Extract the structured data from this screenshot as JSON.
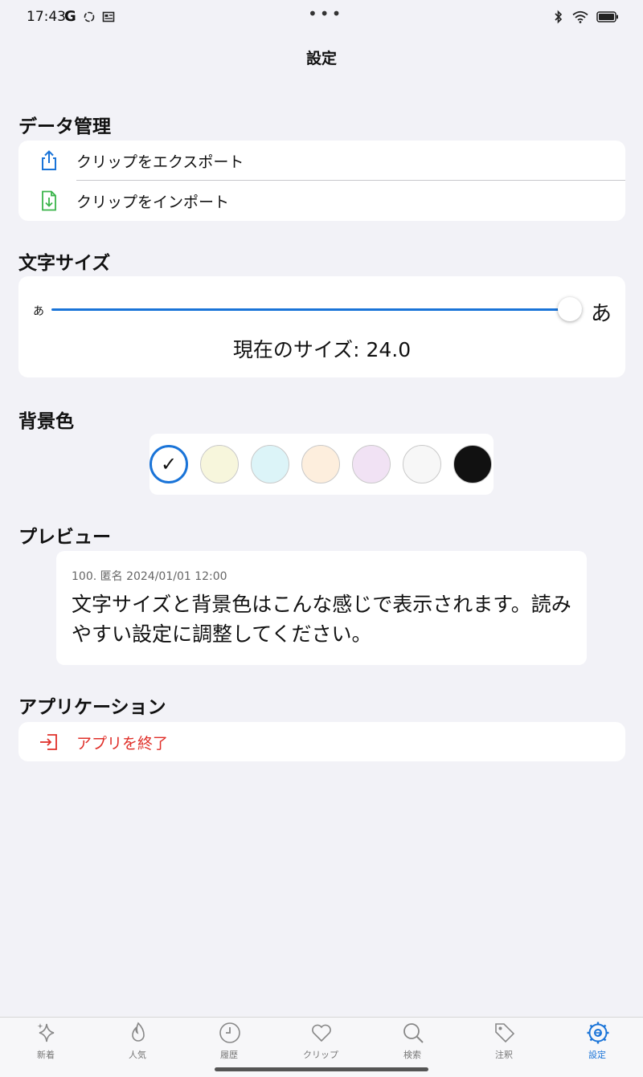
{
  "status": {
    "time": "17:43",
    "g_glyph": "G",
    "dots": "•••"
  },
  "nav": {
    "title": "設定"
  },
  "data_section": {
    "title": "データ管理",
    "export_label": "クリップをエクスポート",
    "import_label": "クリップをインポート",
    "export_icon": "share-icon",
    "import_icon": "file-import-icon"
  },
  "font_section": {
    "title": "文字サイズ",
    "small_glyph": "あ",
    "large_glyph": "あ",
    "readout": "現在のサイズ: 24.0",
    "slider_level": 1.0
  },
  "bg_section": {
    "title": "背景色",
    "check_glyph": "✓",
    "swatches": [
      {
        "color": "#ffffff",
        "selected": true
      },
      {
        "color": "#f7f6dc",
        "selected": false
      },
      {
        "color": "#dcf4f8",
        "selected": false
      },
      {
        "color": "#fdeedd",
        "selected": false
      },
      {
        "color": "#f1e2f4",
        "selected": false
      },
      {
        "color": "#f7f7f7",
        "selected": false
      },
      {
        "color": "#111111",
        "selected": false
      }
    ]
  },
  "preview_section": {
    "title": "プレビュー",
    "meta": "100. 匿名 2024/01/01 12:00",
    "body": "文字サイズと背景色はこんな感じで表示されます。読みやすい設定に調整してください。"
  },
  "app_section": {
    "title": "アプリケーション",
    "exit_label": "アプリを終了",
    "exit_icon": "exit-icon"
  },
  "tabs": [
    {
      "label": "新着",
      "icon": "sparkle-icon",
      "active": false
    },
    {
      "label": "人気",
      "icon": "flame-icon",
      "active": false
    },
    {
      "label": "履歴",
      "icon": "clock-icon",
      "active": false
    },
    {
      "label": "クリップ",
      "icon": "heart-icon",
      "active": false
    },
    {
      "label": "検索",
      "icon": "search-icon",
      "active": false
    },
    {
      "label": "注釈",
      "icon": "tag-icon",
      "active": false
    },
    {
      "label": "設定",
      "icon": "gear-icon",
      "active": true
    }
  ],
  "colors": {
    "accent": "#1a74d8",
    "destructive": "#e0302a",
    "import_green": "#3ab44a",
    "background": "#f2f2f7"
  }
}
